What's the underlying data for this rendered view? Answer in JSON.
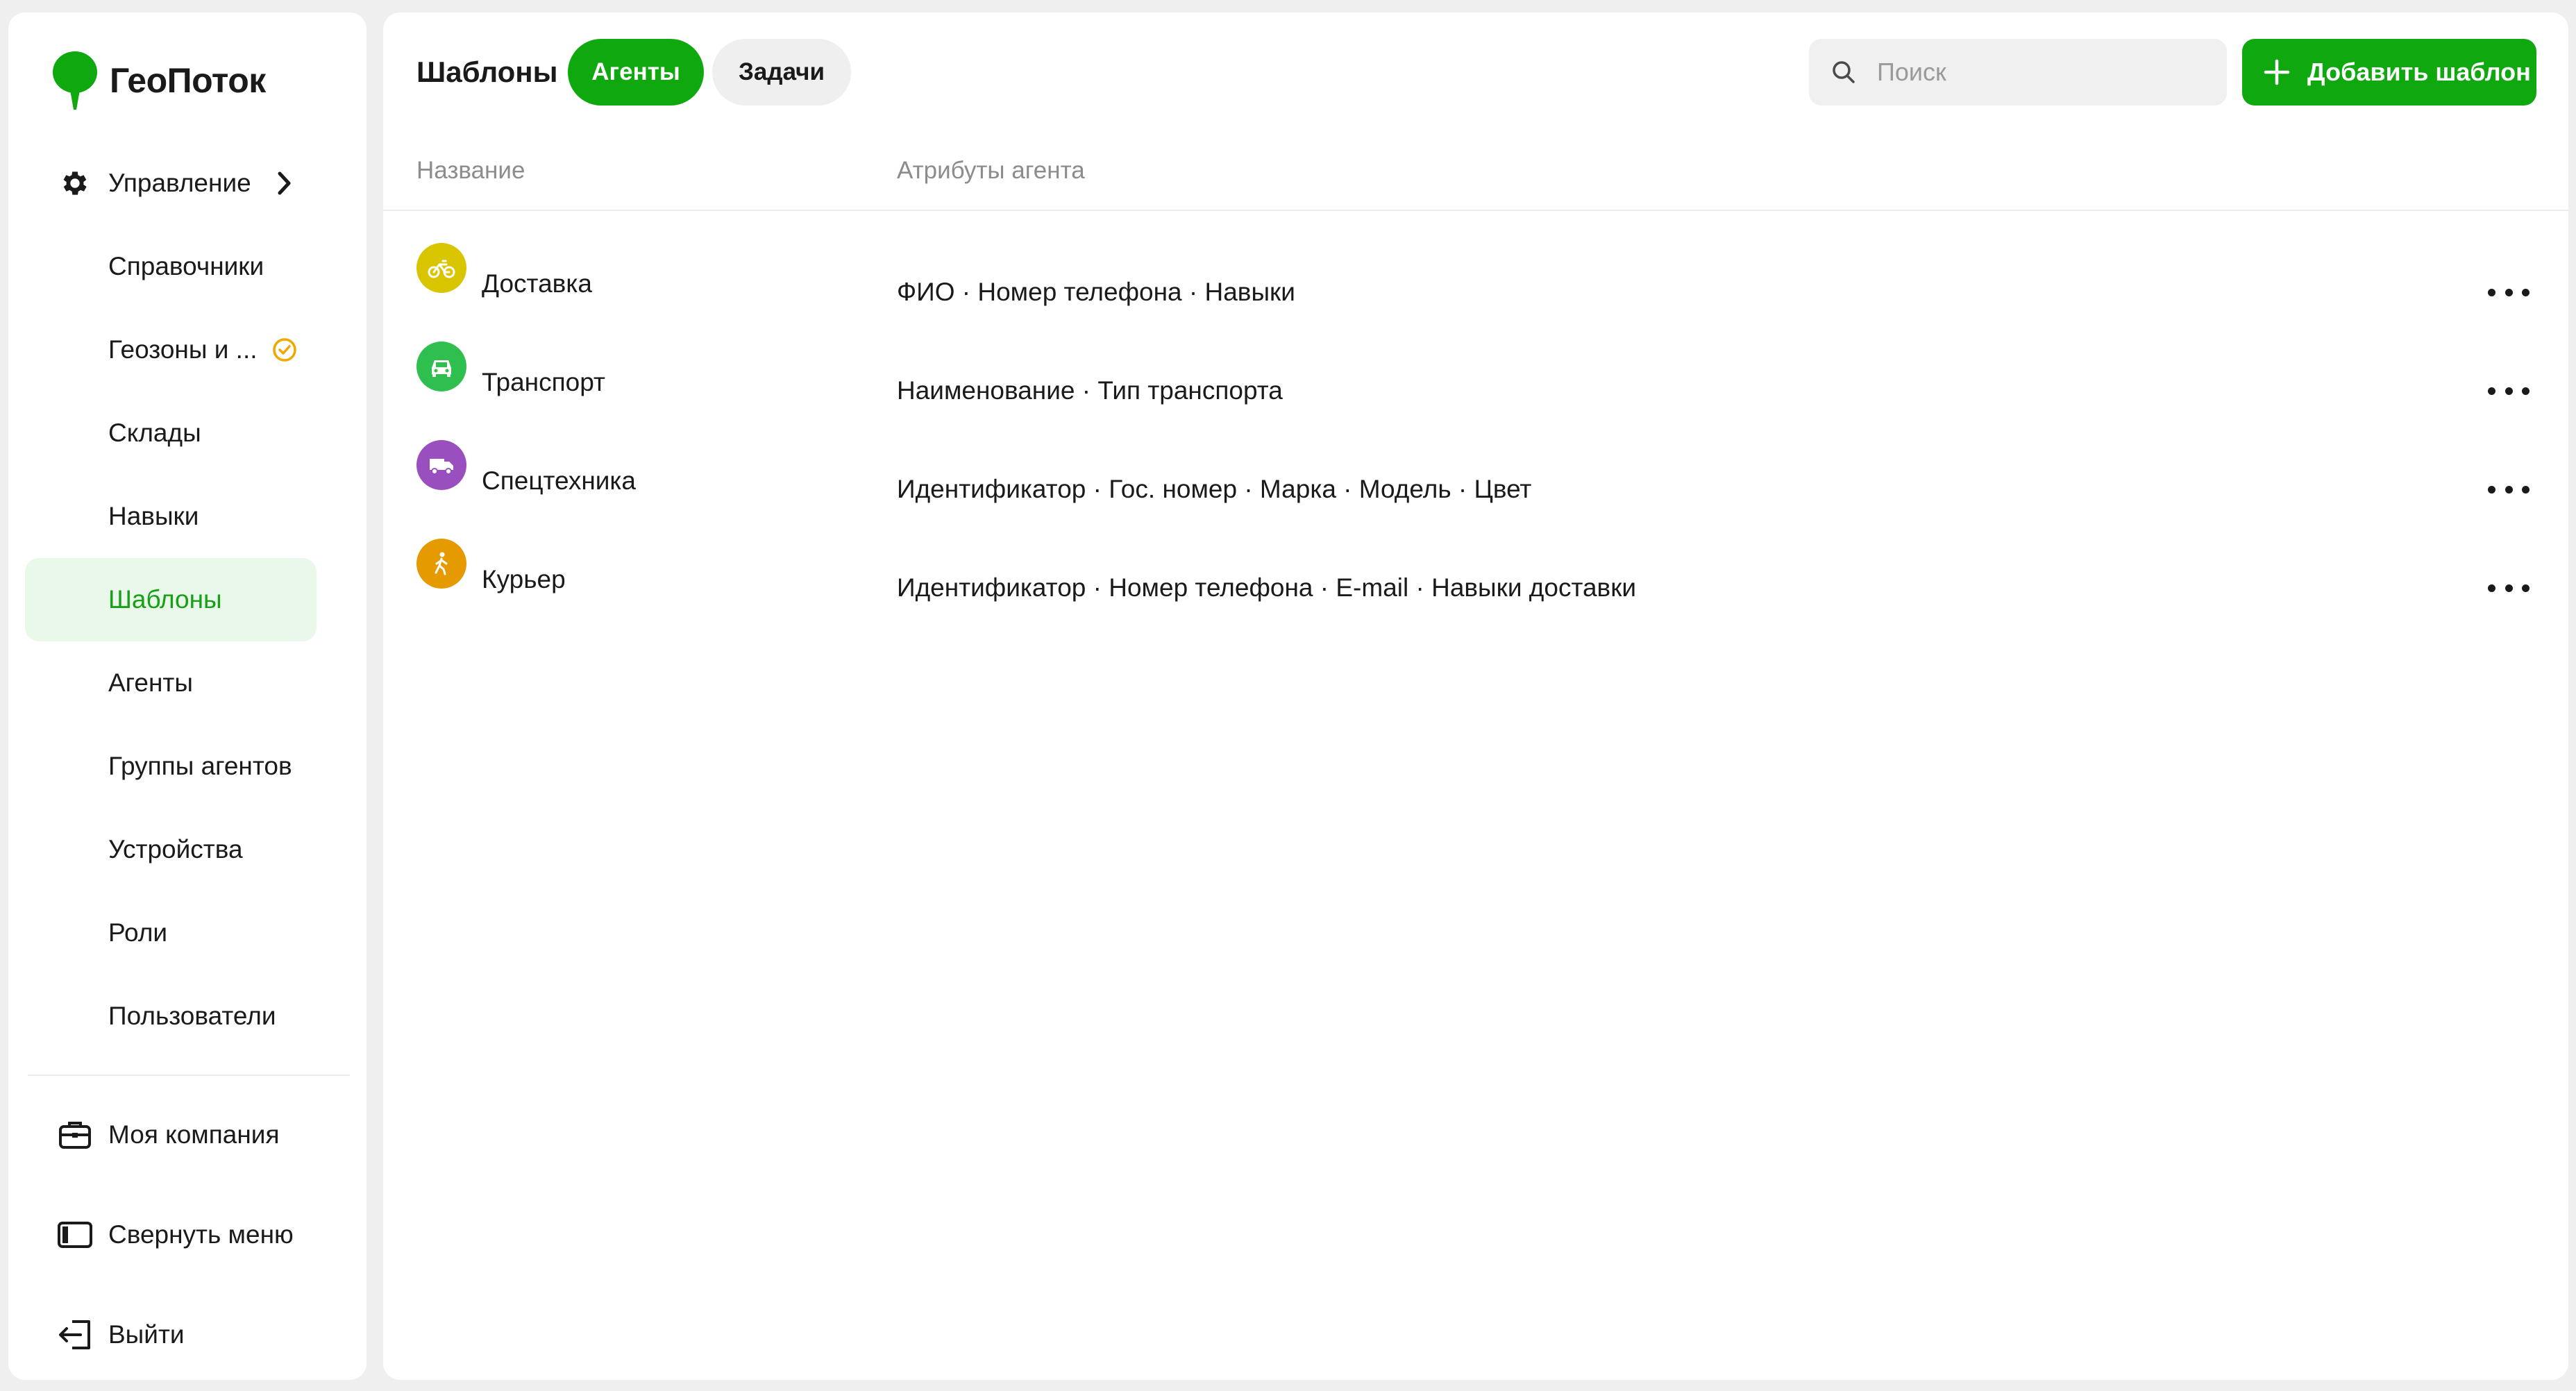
{
  "app": {
    "name": "ГеоПоток",
    "brand_color": "#0fa80e"
  },
  "sidebar": {
    "management": {
      "label": "Управление",
      "icon": "gear-icon"
    },
    "items": [
      {
        "label": "Справочники"
      },
      {
        "label": "Геозоны и ...",
        "badge_icon": "clock-icon"
      },
      {
        "label": "Склады"
      },
      {
        "label": "Навыки"
      },
      {
        "label": "Шаблоны",
        "active": true
      },
      {
        "label": "Агенты"
      },
      {
        "label": "Группы агентов"
      },
      {
        "label": "Устройства"
      },
      {
        "label": "Роли"
      },
      {
        "label": "Пользователи"
      }
    ],
    "bottom": [
      {
        "label": "Моя компания",
        "icon": "briefcase-icon"
      },
      {
        "label": "Свернуть меню",
        "icon": "collapse-panel-icon"
      },
      {
        "label": "Выйти",
        "icon": "logout-icon"
      }
    ]
  },
  "header": {
    "title": "Шаблоны",
    "tabs": [
      {
        "label": "Агенты",
        "active": true
      },
      {
        "label": "Задачи",
        "active": false
      }
    ],
    "search_placeholder": "Поиск",
    "add_button": "Добавить шаблон"
  },
  "table": {
    "columns": [
      "Название",
      "Атрибуты агента"
    ],
    "rows": [
      {
        "name": "Доставка",
        "icon": "bicycle-icon",
        "color": "#d9c400",
        "attributes": "ФИО · Номер телефона · Навыки"
      },
      {
        "name": "Транспорт",
        "icon": "car-icon",
        "color": "#2fbf4f",
        "attributes": "Наименование · Тип транспорта"
      },
      {
        "name": "Спецтехника",
        "icon": "truck-icon",
        "color": "#9a4fbf",
        "attributes": "Идентификатор · Гос. номер · Марка · Модель · Цвет"
      },
      {
        "name": "Курьер",
        "icon": "walking-person-icon",
        "color": "#e59a00",
        "attributes": "Идентификатор · Номер телефона · E-mail · Навыки доставки"
      }
    ]
  }
}
